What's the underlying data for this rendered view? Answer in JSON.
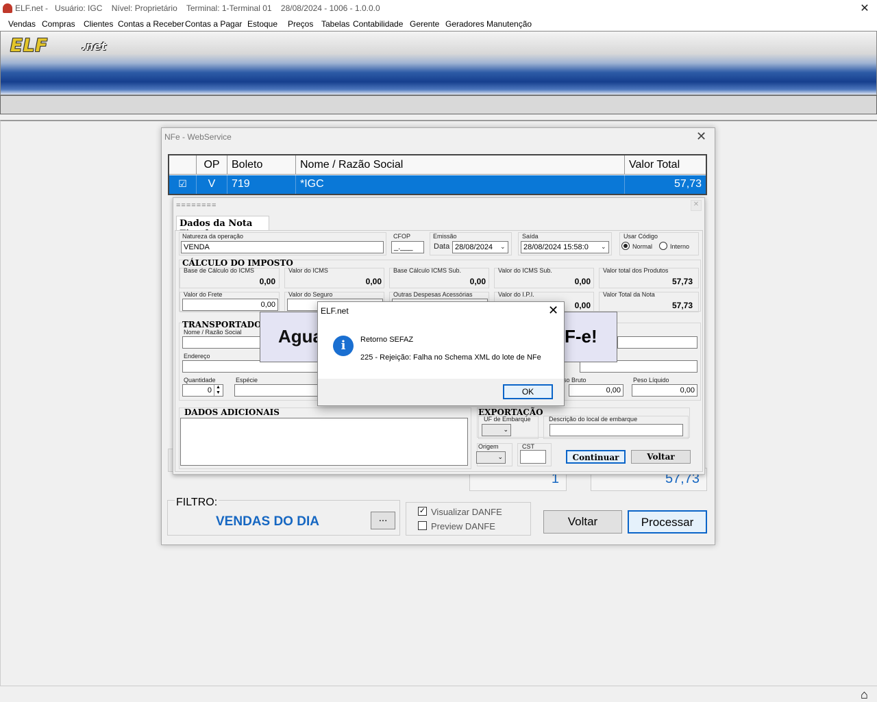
{
  "titlebar": {
    "text": "ELF.net -   Usuário: IGC    Nível: Proprietário    Terminal: 1-Terminal 01    28/08/2024 - 1006 - 1.0.0.0",
    "close": "✕"
  },
  "menu": [
    "Vendas",
    "Compras",
    "Clientes",
    "Contas a Receber",
    "Contas a Pagar",
    "Estoque",
    "Preços",
    "Tabelas",
    "Contabilidade",
    "Gerente",
    "Geradores",
    "Manutenção"
  ],
  "logo": {
    "main": "ELF",
    "suffix": ".net"
  },
  "nfe_window": {
    "title": "NFe - WebService",
    "close": "✕",
    "grid": {
      "headers": [
        "",
        "OP",
        "Boleto",
        "Nome / Razão Social",
        "Valor Total"
      ],
      "row": {
        "checked": "☑",
        "op": "V",
        "boleto": "719",
        "nome": "*IGC",
        "valor": "57,73"
      }
    },
    "count": "1",
    "sum": "57,73",
    "filtro_label": "FILTRO:",
    "filtro_value": "VENDAS DO DIA",
    "filtro_button": "...",
    "visualizar_danfe": "Visualizar DANFE",
    "visualizar_checked": "✓",
    "preview_danfe": "Preview DANFE",
    "voltar": "Voltar",
    "processar": "Processar"
  },
  "nota_fiscal": {
    "title": "========",
    "tab": "Dados da Nota Fiscal",
    "natureza_label": "Natureza da operação",
    "natureza_value": "VENDA",
    "cfop_label": "CFOP",
    "cfop_value": "_.___",
    "emissao_label": "Emissão",
    "data_label": "Data",
    "emissao_value": "28/08/2024",
    "saida_label": "Saída",
    "saida_value": "28/08/2024 15:58:0",
    "usar_codigo_label": "Usar Código",
    "normal_label": "Normal",
    "interno_label": "Interno",
    "calc_title": "CÁLCULO DO IMPOSTO",
    "calc": [
      {
        "label": "Base de Cálculo do ICMS",
        "value": "0,00"
      },
      {
        "label": "Valor do ICMS",
        "value": "0,00"
      },
      {
        "label": "Base Cálculo ICMS Sub.",
        "value": "0,00"
      },
      {
        "label": "Valor do ICMS Sub.",
        "value": "0,00"
      },
      {
        "label": "Valor total dos Produtos",
        "value": "57,73"
      }
    ],
    "frete_label": "Valor do Frete",
    "frete_value": "0,00",
    "seguro_label": "Valor do Seguro",
    "outras_label": "Outras Despesas Acessórias",
    "ipi_label": "Valor do I.P.I.",
    "ipi_value": "0,00",
    "total_nota_label": "Valor Total da Nota",
    "total_nota_value": "57,73",
    "transp_title": "TRANSPORTADOR /",
    "razao_label": "Nome / Razão Social",
    "endereco_label": "Endereço",
    "quantidade_label": "Quantidade",
    "quantidade_value": "0",
    "especie_label": "Espécie",
    "peso_bruto_label": "so Bruto",
    "peso_bruto_value": "0,00",
    "peso_liquido_label": "Peso Líquido",
    "peso_liquido_value": "0,00",
    "dados_adicionais": "DADOS ADICIONAIS",
    "exportacao": "EXPORTAÇÃO",
    "uf_embarque_label": "UF de Embarque",
    "desc_embarque_label": "Descrição do local de embarque",
    "origem_label": "Origem",
    "cst_label": "CST",
    "continuar": "Continuar",
    "voltar": "Voltar"
  },
  "wait_overlay": {
    "left_text": "Agua",
    "right_text": "F-e!"
  },
  "message_box": {
    "title": "ELF.net",
    "close": "✕",
    "icon": "info-icon",
    "heading": "Retorno SEFAZ",
    "body": "225 - Rejeição: Falha no Schema XML do lote de NFe",
    "ok": "OK"
  }
}
